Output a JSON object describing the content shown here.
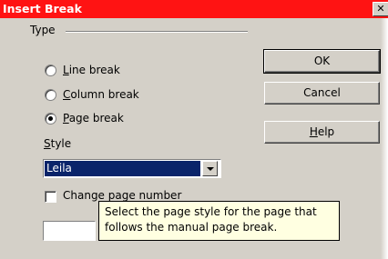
{
  "window": {
    "title": "Insert Break",
    "close_glyph": "✕",
    "title_bar_color": "#ff1313"
  },
  "type_group": {
    "label": "Type",
    "options": [
      {
        "prefix": "",
        "mnemonic": "L",
        "rest": "ine break",
        "selected": false
      },
      {
        "prefix": "",
        "mnemonic": "C",
        "rest": "olumn break",
        "selected": false
      },
      {
        "prefix": "",
        "mnemonic": "P",
        "rest": "age break",
        "selected": true
      }
    ]
  },
  "style": {
    "label_mnemonic": "S",
    "label_rest": "tyle",
    "selected_value": "Leila"
  },
  "change_page_number": {
    "label": "Change page number",
    "checked": false
  },
  "page_number_value": "",
  "buttons": {
    "ok": "OK",
    "cancel": "Cancel",
    "help_mnemonic": "H",
    "help_rest": "elp"
  },
  "tooltip": {
    "line1": "Select the page style for the page that",
    "line2": "follows the manual page break."
  }
}
